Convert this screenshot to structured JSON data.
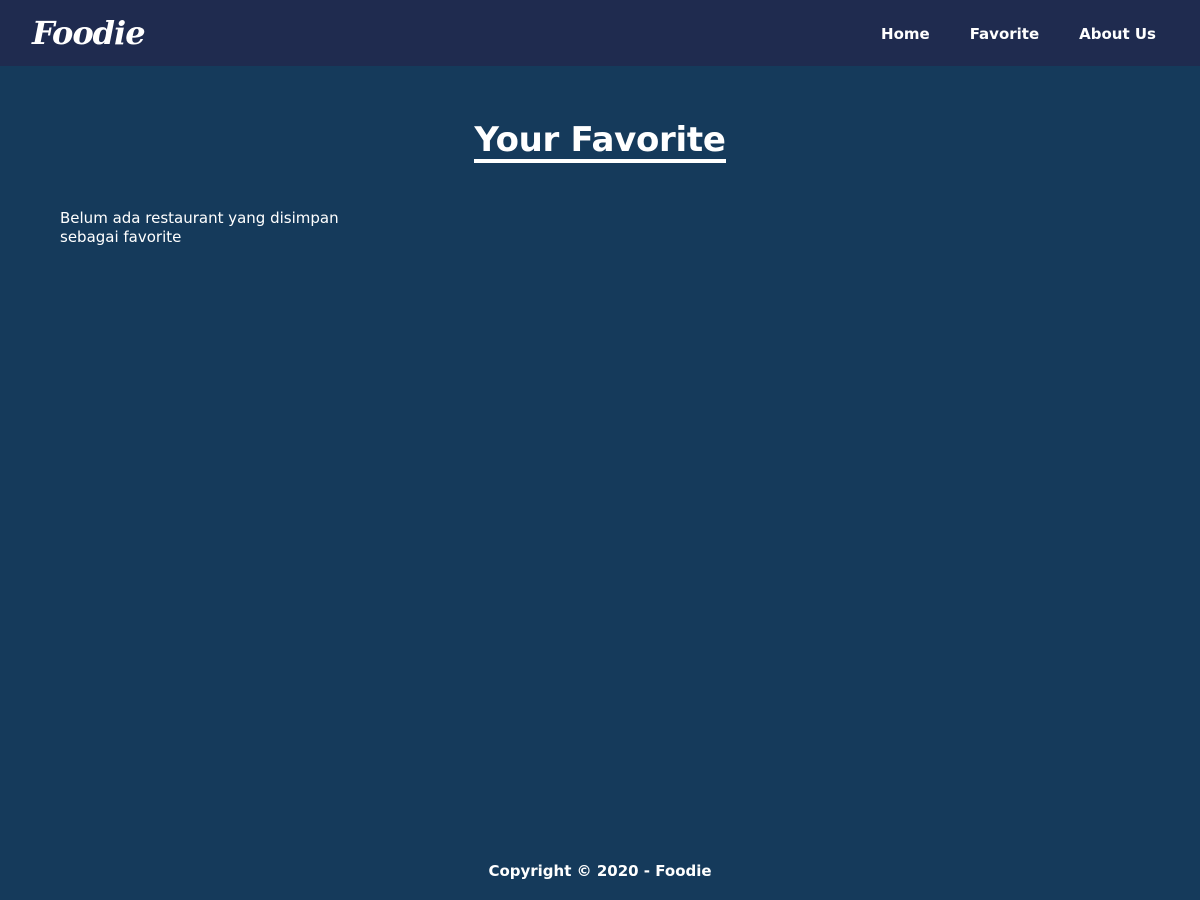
{
  "header": {
    "brand": "Foodie",
    "nav": [
      {
        "label": "Home"
      },
      {
        "label": "Favorite"
      },
      {
        "label": "About Us"
      }
    ]
  },
  "main": {
    "title": "Your Favorite",
    "empty_message": "Belum ada restaurant yang disimpan sebagai favorite"
  },
  "footer": {
    "copyright": "Copyright © 2020 - Foodie"
  },
  "colors": {
    "navbar_bg": "#1f2b4f",
    "page_bg": "#153a5b",
    "text": "#ffffff"
  }
}
